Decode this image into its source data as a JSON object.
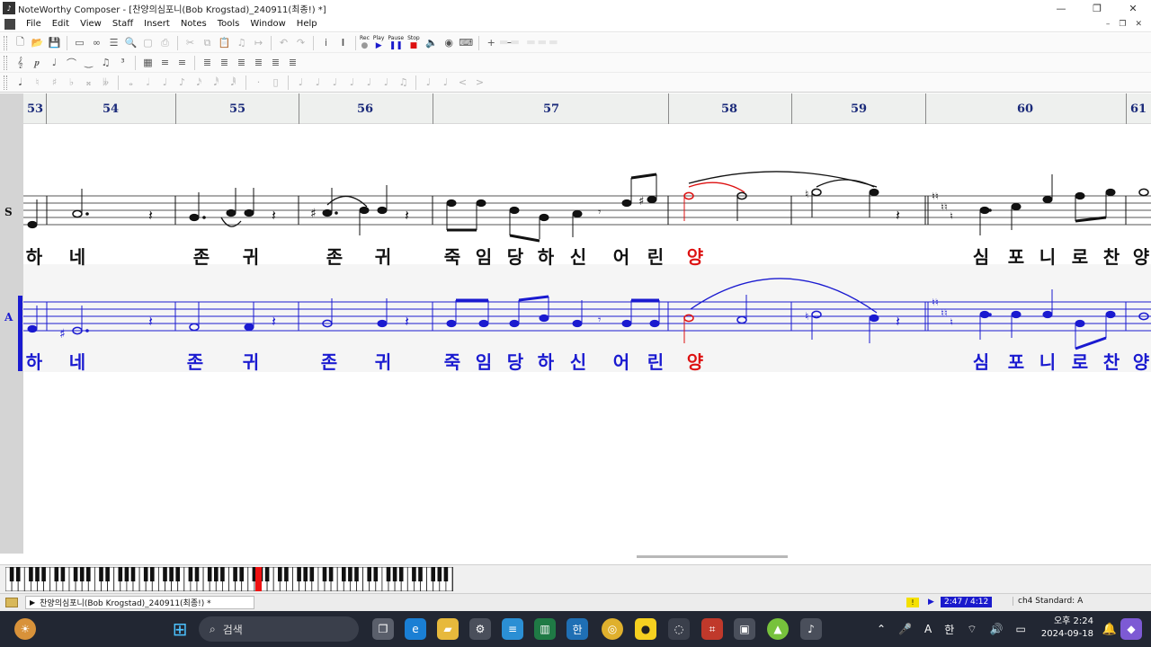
{
  "window": {
    "title": "NoteWorthy Composer - [찬양의심포니(Bob Krogstad)_240911(최종!) *]",
    "controls": {
      "minimize": "—",
      "maximize": "❐",
      "close": "✕"
    }
  },
  "menu": [
    "File",
    "Edit",
    "View",
    "Staff",
    "Insert",
    "Notes",
    "Tools",
    "Window",
    "Help"
  ],
  "toolbar": {
    "play_label": "Play",
    "pause_label": "Pause",
    "stop_label": "Stop",
    "rec_label": "Rec"
  },
  "ruler": {
    "measures": [
      {
        "num": "53"
      },
      {
        "num": "54"
      },
      {
        "num": "55"
      },
      {
        "num": "56"
      },
      {
        "num": "57"
      },
      {
        "num": "58"
      },
      {
        "num": "59"
      },
      {
        "num": "60"
      },
      {
        "num": "61"
      }
    ]
  },
  "staves": {
    "soprano": {
      "label": "S",
      "color": "#111111",
      "lyrics": [
        "하",
        "네",
        "존",
        "귀",
        "존",
        "귀",
        "죽",
        "임",
        "당",
        "하",
        "신",
        "어",
        "린",
        "양",
        "심",
        "포",
        "니",
        "로",
        "찬",
        "양"
      ]
    },
    "alto": {
      "label": "A",
      "color": "#1a1ad0",
      "lyrics": [
        "하",
        "네",
        "존",
        "귀",
        "존",
        "귀",
        "죽",
        "임",
        "당",
        "하",
        "신",
        "어",
        "린",
        "양",
        "심",
        "포",
        "니",
        "로",
        "찬",
        "양"
      ]
    },
    "highlight_color": "#dd1111",
    "highlight_syllable": "양"
  },
  "status": {
    "document": "찬양의심포니(Bob Krogstad)_240911(최종!) *",
    "marker": "!",
    "time": "2:47 / 4:12",
    "info": "ch4 Standard: A"
  },
  "taskbar": {
    "search_placeholder": "검색",
    "ime_lang": "A",
    "ime_mode": "한",
    "time": "오후 2:24",
    "date": "2024-09-18"
  }
}
